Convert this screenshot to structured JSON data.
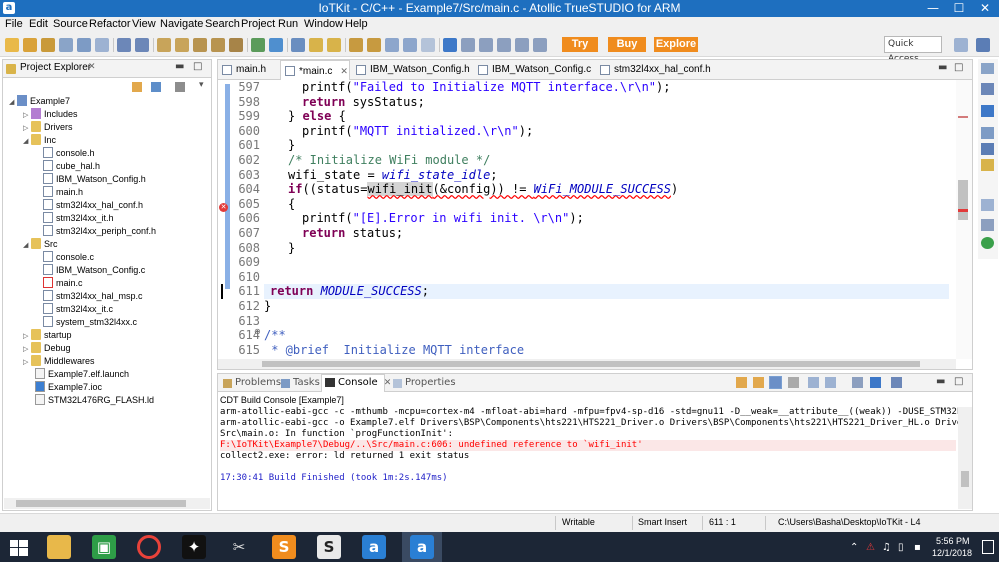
{
  "window": {
    "title": "IoTKit - C/C++ - Example7/Src/main.c - Atollic TrueSTUDIO for ARM",
    "app_icon": "a"
  },
  "menu": [
    "File",
    "Edit",
    "Source",
    "Refactor",
    "View",
    "Navigate",
    "Search",
    "Project",
    "Run",
    "Window",
    "Help"
  ],
  "toolbar": {
    "try_label": "Try",
    "buy_label": "Buy",
    "explore_label": "Explore",
    "quick_access": "Quick Access",
    "accent_color": "#f08c1e"
  },
  "explorer": {
    "title": "Project Explorer",
    "items": [
      {
        "label": "Example7",
        "icon": "project-icon"
      },
      {
        "label": "Includes",
        "icon": "includes-icon"
      },
      {
        "label": "Drivers",
        "icon": "folder-icon"
      },
      {
        "label": "Inc",
        "icon": "folder-icon"
      },
      {
        "label": "console.h",
        "icon": "header-file-icon"
      },
      {
        "label": "cube_hal.h",
        "icon": "header-file-icon"
      },
      {
        "label": "IBM_Watson_Config.h",
        "icon": "header-file-icon"
      },
      {
        "label": "main.h",
        "icon": "header-file-icon"
      },
      {
        "label": "stm32l4xx_hal_conf.h",
        "icon": "header-file-icon"
      },
      {
        "label": "stm32l4xx_it.h",
        "icon": "header-file-icon"
      },
      {
        "label": "stm32l4xx_periph_conf.h",
        "icon": "header-file-icon"
      },
      {
        "label": "Src",
        "icon": "folder-icon"
      },
      {
        "label": "console.c",
        "icon": "c-file-icon"
      },
      {
        "label": "IBM_Watson_Config.c",
        "icon": "c-file-icon"
      },
      {
        "label": "main.c",
        "icon": "c-file-icon"
      },
      {
        "label": "stm32l4xx_hal_msp.c",
        "icon": "c-file-icon"
      },
      {
        "label": "stm32l4xx_it.c",
        "icon": "c-file-icon"
      },
      {
        "label": "system_stm32l4xx.c",
        "icon": "c-file-icon"
      },
      {
        "label": "startup",
        "icon": "folder-icon"
      },
      {
        "label": "Debug",
        "icon": "folder-icon"
      },
      {
        "label": "Middlewares",
        "icon": "folder-icon"
      },
      {
        "label": "Example7.elf.launch",
        "icon": "file-icon"
      },
      {
        "label": "Example7.ioc",
        "icon": "file-icon"
      },
      {
        "label": "STM32L476RG_FLASH.ld",
        "icon": "file-icon"
      }
    ]
  },
  "editor": {
    "tabs": [
      "main.h",
      "*main.c",
      "IBM_Watson_Config.h",
      "IBM_Watson_Config.c",
      "stm32l4xx_hal_conf.h"
    ],
    "line_numbers": [
      "597",
      "598",
      "599",
      "600",
      "601",
      "602",
      "603",
      "604",
      "605",
      "606",
      "607",
      "608",
      "609",
      "610",
      "611",
      "612",
      "613",
      "614",
      "615"
    ],
    "code": {
      "l597_fn": "printf",
      "l597_str": "\"Failed to Initialize MQTT interface.\\r\\n\"",
      "l597_end": ");",
      "l598_kw": "return",
      "l598_rest": " sysStatus;",
      "l599_a": "} ",
      "l599_kw": "else",
      "l599_b": " {",
      "l600_fn": "printf",
      "l600_str": "\"MQTT initialized.\\r\\n\"",
      "l600_end": ");",
      "l601": "}",
      "l602": "/* Initialize WiFi module */",
      "l603_a": "wifi_state = ",
      "l603_b": "wifi_state_idle",
      "l603_c": ";",
      "l604_kw": "if",
      "l604_a": "((status=",
      "l604_err": "wifi_init",
      "l604_b": "(&config)) != ",
      "l604_c": "WiFi_MODULE_SUCCESS",
      "l604_d": ")",
      "l605": "{",
      "l606_fn": "printf",
      "l606_str": "\"[E].Error in wifi init. \\r\\n\"",
      "l606_end": ");",
      "l607_kw": "return",
      "l607_rest": " status;",
      "l608": "}",
      "l611_kw": "return",
      "l611_it": "MODULE_SUCCESS",
      "l611_end": ";",
      "l612": "}",
      "l614": "/**",
      "l615": " * @brief  Initialize MQTT interface"
    }
  },
  "console": {
    "tabs": [
      "Problems",
      "Tasks",
      "Console",
      "Properties"
    ],
    "header": "CDT Build Console [Example7]",
    "lines": [
      "arm-atollic-eabi-gcc -c -mthumb -mcpu=cortex-m4 -mfloat-abi=hard -mfpu=fpv4-sp-d16 -std=gnu11 -D__weak=__attribute__((weak)) -DUSE_STM32L4XX_NUC",
      "arm-atollic-eabi-gcc -o Example7.elf Drivers\\BSP\\Components\\hts221\\HTS221_Driver.o Drivers\\BSP\\Components\\hts221\\HTS221_Driver_HL.o Drivers\\BSP\\",
      "Src\\main.o: In function `progFunctionInit':",
      "F:\\IoTKit\\Example7\\Debug/..\\Src/main.c:606: undefined reference to `wifi_init'",
      "collect2.exe: error: ld returned 1 exit status",
      "17:30:41 Build Finished (took 1m:2s.147ms)"
    ]
  },
  "status": {
    "mode": "Writable",
    "insert": "Smart Insert",
    "position": "611 : 1",
    "path": "C:\\Users\\Basha\\Desktop\\IoTKit - L4"
  },
  "taskbar": {
    "time": "5:56 PM",
    "date": "12/1/2018"
  }
}
